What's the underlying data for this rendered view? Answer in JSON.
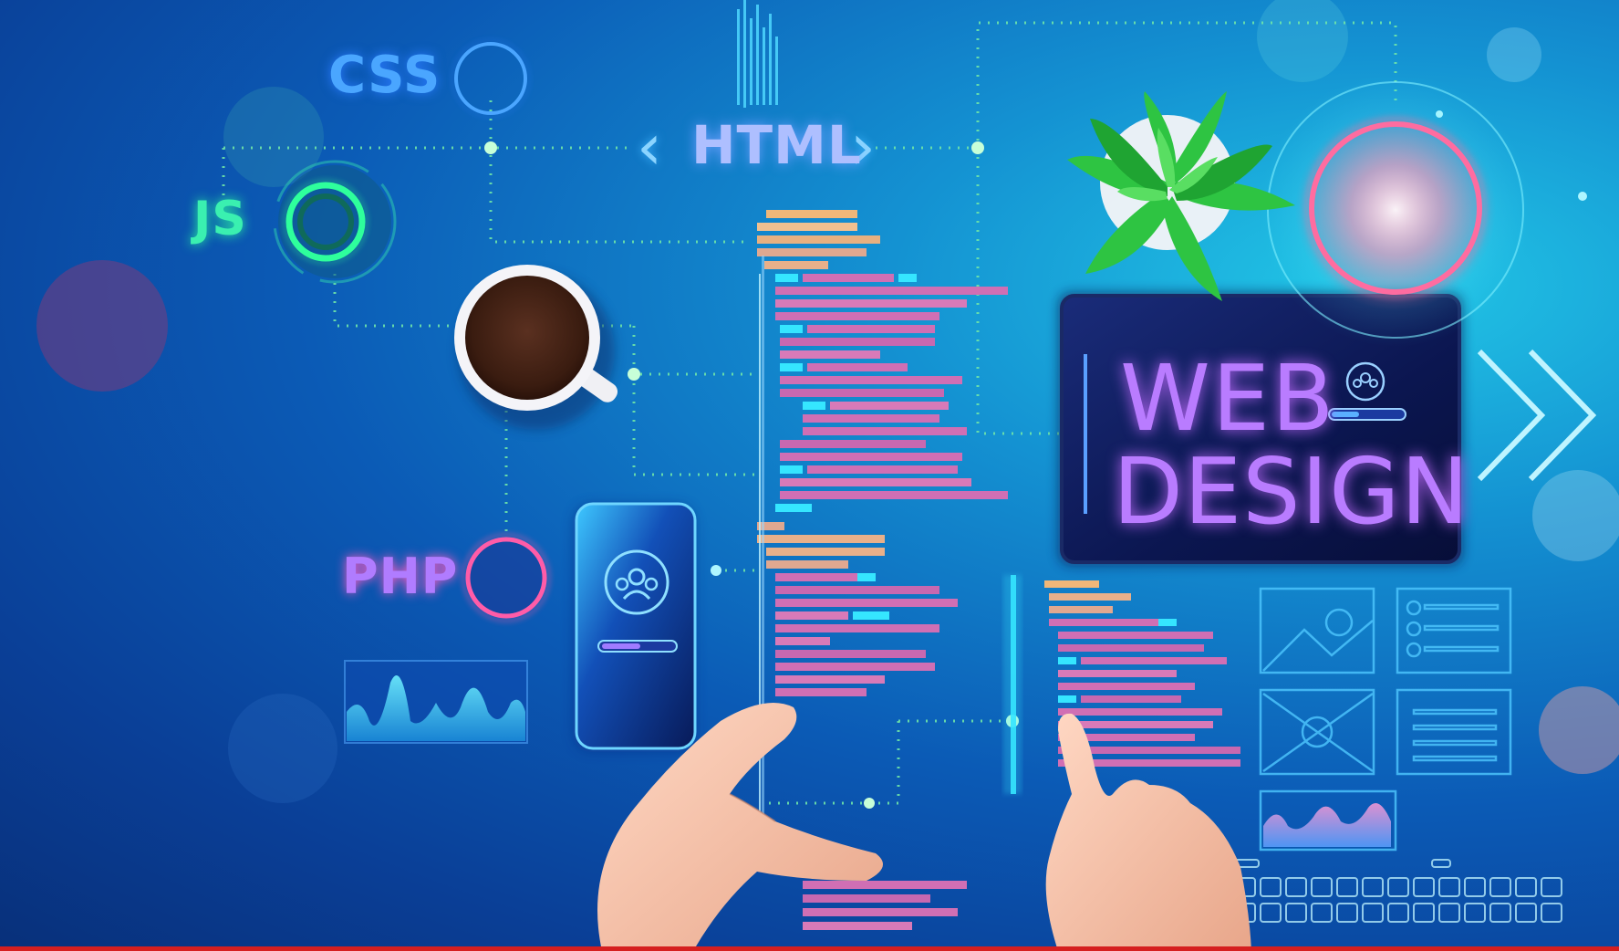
{
  "labels": {
    "css": "CSS",
    "js": "JS",
    "php": "PHP",
    "html": "HTML",
    "web": "WEB",
    "design": "DESIGN"
  },
  "colors": {
    "bg_dark": "#08307a",
    "bg_light": "#22c7e6",
    "neon_pink": "#ff5cc8",
    "neon_green": "#27f2a0",
    "neon_blue": "#4aa6ff",
    "neon_purple": "#b97cff",
    "code_pink": "#d06fb4",
    "code_cyan": "#35e6ff",
    "code_orange": "#f0b779",
    "bottom_bar": "#d51f1f"
  }
}
